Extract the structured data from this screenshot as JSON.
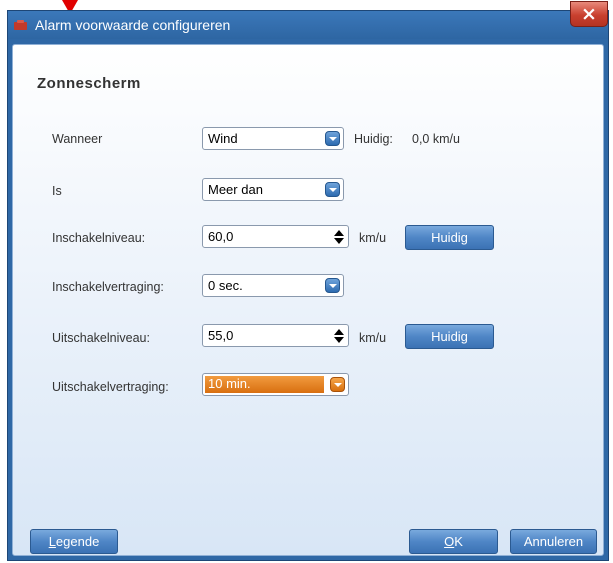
{
  "window": {
    "title": "Alarm voorwaarde configureren",
    "close_glyph": "×"
  },
  "section_title": "Zonnescherm",
  "rows": {
    "wanneer": {
      "label": "Wanneer",
      "value": "Wind",
      "current_label": "Huidig:",
      "current_value": "0,0 km/u"
    },
    "is": {
      "label": "Is",
      "value": "Meer dan"
    },
    "inschakelniveau": {
      "label": "Inschakelniveau:",
      "value": "60,0",
      "unit": "km/u",
      "button": "Huidig"
    },
    "inschakelvertraging": {
      "label": "Inschakelvertraging:",
      "value": "0 sec."
    },
    "uitschakelniveau": {
      "label": "Uitschakelniveau:",
      "value": "55,0",
      "unit": "km/u",
      "button": "Huidig"
    },
    "uitschakelvertraging": {
      "label": "Uitschakelvertraging:",
      "value": "10 min."
    }
  },
  "footer": {
    "legend_button": "Legende",
    "ok_button": "OK",
    "cancel_button": "Annuleren"
  },
  "icons": {
    "title": "alarm-icon",
    "dropdown": "chevron-down-icon",
    "spinner": "spinner-arrows-icon",
    "marker": "red-triangle-marker"
  },
  "colors": {
    "title_bar": "#2f68a6",
    "close_button": "#c9402f",
    "button_blue": "#4f86c6",
    "highlight_orange": "#e07c1c"
  }
}
